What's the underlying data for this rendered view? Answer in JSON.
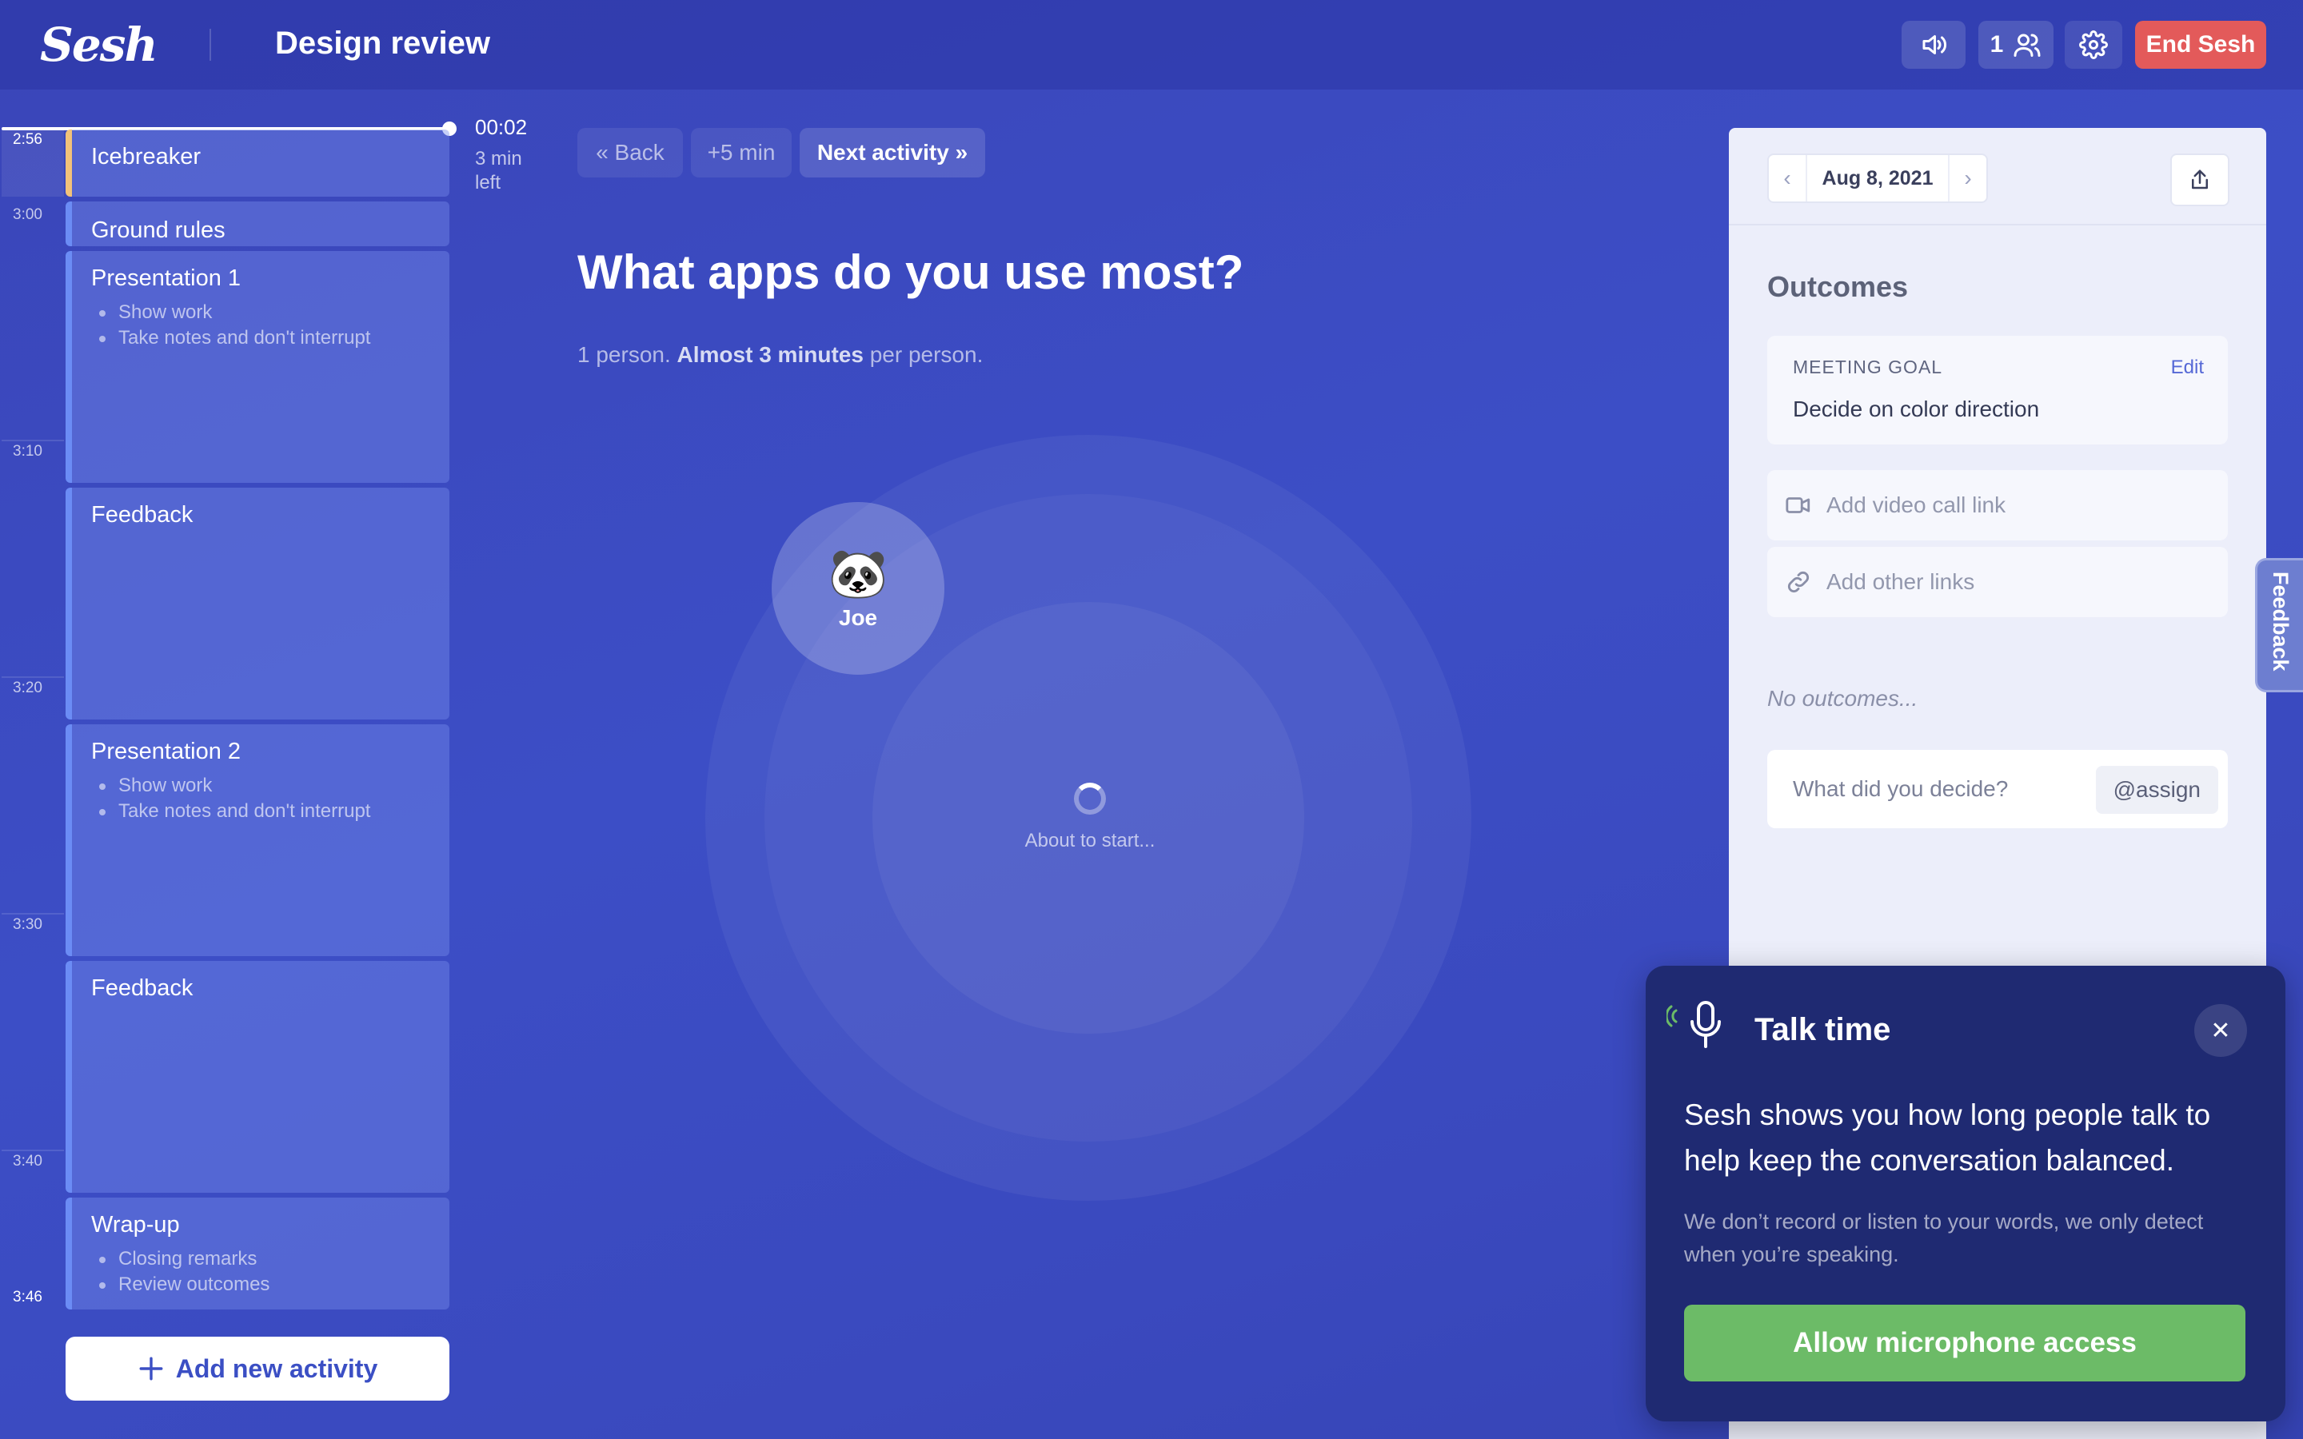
{
  "app": {
    "logo": "Sesh",
    "title": "Design review"
  },
  "toolbar": {
    "sound_icon": "speaker-icon",
    "participant_count": "1",
    "people_icon": "people-icon",
    "settings_icon": "gear-icon",
    "end_label": "End Sesh",
    "end_color": "#e35a5a"
  },
  "timeline": {
    "elapsed": "00:02",
    "remaining": "3 min left",
    "current_time": "2:56",
    "end_time": "3:46",
    "ticks": [
      "3:00",
      "3:10",
      "3:20",
      "3:30",
      "3:40"
    ]
  },
  "agenda": {
    "activities": [
      {
        "title": "Icebreaker",
        "items": [],
        "active": true
      },
      {
        "title": "Ground rules",
        "items": []
      },
      {
        "title": "Presentation 1",
        "items": [
          "Show work",
          "Take notes and don't interrupt"
        ]
      },
      {
        "title": "Feedback",
        "items": []
      },
      {
        "title": "Presentation 2",
        "items": [
          "Show work",
          "Take notes and don't interrupt"
        ]
      },
      {
        "title": "Feedback",
        "items": []
      },
      {
        "title": "Wrap-up",
        "items": [
          "Closing remarks",
          "Review outcomes"
        ]
      }
    ],
    "add_label": "Add new activity"
  },
  "controls": {
    "back": "« Back",
    "plus5": "+5 min",
    "next": "Next activity »"
  },
  "activity": {
    "question": "What apps do you use most?",
    "sub_count": "1 person.",
    "sub_time": "Almost 3 minutes",
    "sub_suffix": "per person.",
    "participant": {
      "name": "Joe",
      "avatar": "🐼"
    },
    "status": "About to start..."
  },
  "outcomes": {
    "date": "Aug 8, 2021",
    "title": "Outcomes",
    "goal_label": "MEETING GOAL",
    "goal_edit": "Edit",
    "goal_text": "Decide on color direction",
    "video_placeholder": "Add video call link",
    "links_placeholder": "Add other links",
    "empty": "No outcomes...",
    "decide_placeholder": "What did you decide?",
    "assign": "@assign"
  },
  "feedback_tab": "Feedback",
  "talk_time": {
    "title": "Talk time",
    "body": "Sesh shows you how long people talk to help keep the conversation balanced.",
    "note": "We don’t record or listen to your words, we only detect when you’re speaking.",
    "allow_label": "Allow microphone access",
    "allow_color": "#6cbb67"
  }
}
